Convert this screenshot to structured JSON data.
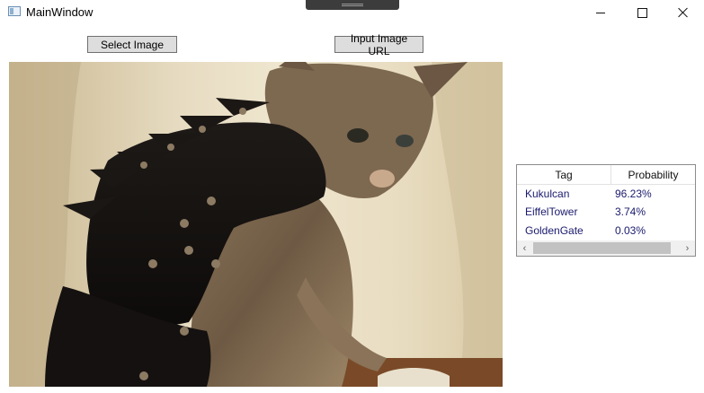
{
  "window": {
    "title": "MainWindow"
  },
  "toolbar": {
    "select_image_label": "Select Image",
    "input_url_label": "Input Image URL"
  },
  "results": {
    "columns": [
      "Tag",
      "Probability"
    ],
    "rows": [
      {
        "tag": "Kukulcan",
        "probability": "96.23%"
      },
      {
        "tag": "EiffelTower",
        "probability": "3.74%"
      },
      {
        "tag": "GoldenGate",
        "probability": "0.03%"
      }
    ]
  },
  "icons": {
    "app": "window-app-icon",
    "minimize": "minimize-icon",
    "maximize": "maximize-icon",
    "close": "close-icon",
    "scroll_left": "chevron-left-icon",
    "scroll_right": "chevron-right-icon"
  },
  "image": {
    "subject": "cat-in-spiked-leather-armor"
  }
}
